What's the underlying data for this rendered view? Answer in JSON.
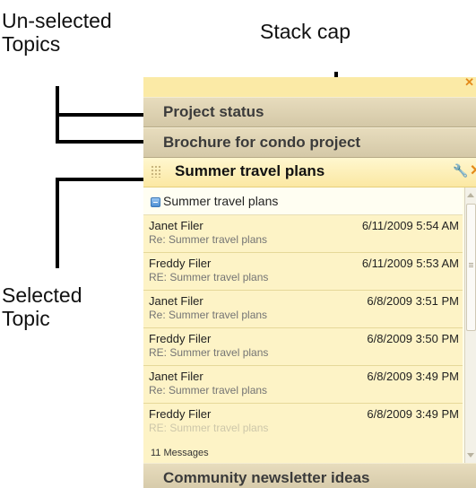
{
  "callouts": {
    "unselected": "Un-selected\nTopics",
    "stack_cap": "Stack cap",
    "selected": "Selected\nTopic"
  },
  "panel": {
    "cap_close_icon": "close-icon",
    "topics_top": [
      {
        "label": "Project status"
      },
      {
        "label": "Brochure for condo project"
      }
    ],
    "selected_topic": {
      "label": "Summer travel plans",
      "wrench_icon": "wrench-icon",
      "close_icon": "close-icon",
      "group_label": "Summer travel plans",
      "messages": [
        {
          "sender": "Janet Filer",
          "subject": "Re: Summer travel plans",
          "date": "6/11/2009  5:54 AM"
        },
        {
          "sender": "Freddy Filer",
          "subject": "RE: Summer travel plans",
          "date": "6/11/2009  5:53 AM"
        },
        {
          "sender": "Janet Filer",
          "subject": "Re: Summer travel plans",
          "date": "6/8/2009  3:51 PM"
        },
        {
          "sender": "Freddy Filer",
          "subject": "RE: Summer travel plans",
          "date": "6/8/2009  3:50 PM"
        },
        {
          "sender": "Janet Filer",
          "subject": "Re: Summer travel plans",
          "date": "6/8/2009  3:49 PM"
        },
        {
          "sender": "Freddy Filer",
          "subject": "RE: Summer travel plans",
          "date": "6/8/2009  3:49 PM"
        }
      ],
      "message_count": "11 Messages"
    },
    "topics_bottom": [
      {
        "label": "Community newsletter ideas"
      }
    ]
  },
  "colors": {
    "accent_orange": "#e38a1b",
    "cap_yellow": "#fbeaa6",
    "selected_bg": "#fff7cf"
  }
}
